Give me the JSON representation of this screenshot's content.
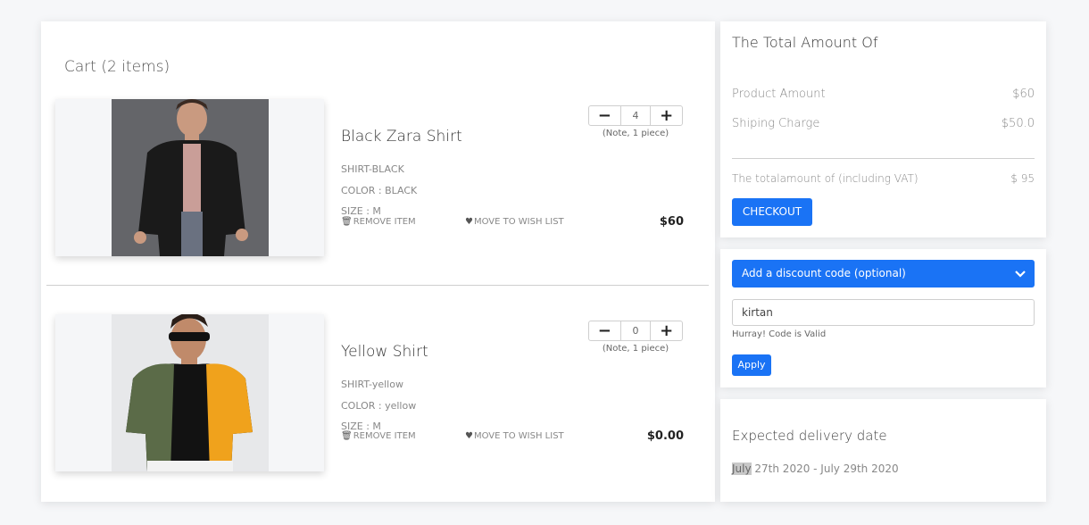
{
  "cart": {
    "title": "Cart (2 items)",
    "items": [
      {
        "name": "Black Zara Shirt",
        "sku": "SHIRT-BLACK",
        "color": "COLOR : BLACK",
        "size": "SIZE : M",
        "quantity": "4",
        "note": "(Note, 1 piece)",
        "remove_label": "REMOVE ITEM",
        "wishlist_label": "MOVE TO WISH LIST",
        "price": "$60",
        "minus": "−",
        "plus": "+"
      },
      {
        "name": "Yellow Shirt",
        "sku": "SHIRT-yellow",
        "color": "COLOR : yellow",
        "size": "SIZE : M",
        "quantity": "0",
        "note": "(Note, 1 piece)",
        "remove_label": "REMOVE ITEM",
        "wishlist_label": "MOVE TO WISH LIST",
        "price": "$0.00",
        "minus": "−",
        "plus": "+"
      }
    ]
  },
  "summary": {
    "title": "The Total Amount Of",
    "product_amount_label": "Product Amount",
    "product_amount_value": "$60",
    "shipping_label": "Shiping Charge",
    "shipping_value": "$50.0",
    "total_label": "The totalamount of (including VAT)",
    "total_value": "$ 95",
    "checkout_label": "CHECKOUT"
  },
  "discount": {
    "header_label": "Add a discount code (optional)",
    "code_value": "kirtan",
    "valid_message": "Hurray! Code is Valid",
    "apply_label": "Apply"
  },
  "delivery": {
    "title": "Expected delivery date",
    "date_highlight": "July",
    "date_rest": " 27th 2020 - July 29th 2020"
  },
  "icons": {
    "trash": "trash-icon",
    "heart": "heart-icon",
    "chevron": "chevron-down-icon"
  },
  "colors": {
    "accent": "#1a73f5",
    "background": "#f6f7f9"
  }
}
